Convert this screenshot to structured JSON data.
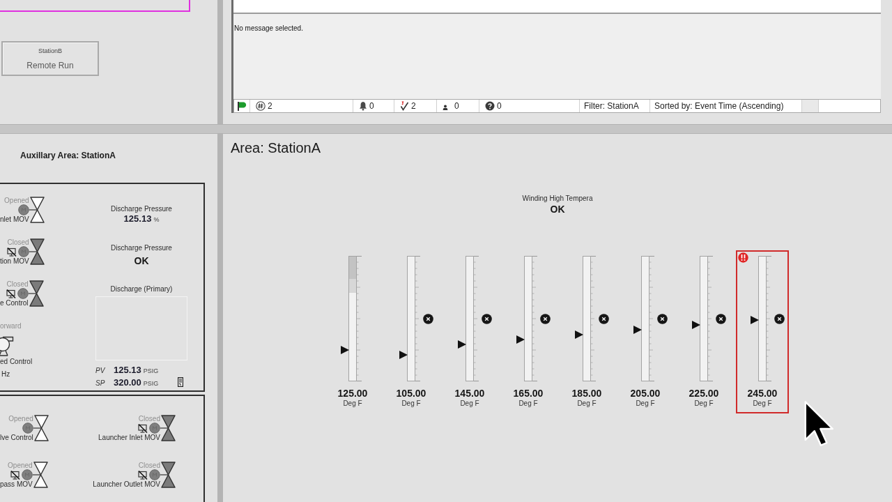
{
  "station_button": {
    "station": "StationB",
    "label": "Remote Run"
  },
  "alarm_viewer": {
    "message": "No message selected.",
    "status_bar": {
      "counters": [
        {
          "kind": "total",
          "value": "2"
        },
        {
          "kind": "bell",
          "value": "0"
        },
        {
          "kind": "acked",
          "value": "2"
        },
        {
          "kind": "shelved",
          "value": "0"
        },
        {
          "kind": "unknown",
          "value": "0"
        }
      ],
      "filter": "Filter: StationA",
      "sort": "Sorted by: Event Time (Ascending)"
    }
  },
  "aux_area": {
    "title": "Auxillary Area: StationA",
    "upper_valves": [
      {
        "status": "Opened",
        "open": true,
        "remote_disabled": false,
        "label": "nlet MOV"
      },
      {
        "status": "Closed",
        "open": false,
        "remote_disabled": true,
        "label": "tion MOV"
      },
      {
        "status": "Closed",
        "open": false,
        "remote_disabled": true,
        "label": "e Control"
      }
    ],
    "pump": {
      "status": "orward",
      "label": "ed Control",
      "reading": "Hz"
    },
    "readouts": [
      {
        "kind": "value",
        "label": "Discharge Pressure",
        "value": "125.13",
        "unit": "%"
      },
      {
        "kind": "status",
        "label": "Discharge Pressure",
        "value": "OK"
      }
    ],
    "trend": {
      "title": "Discharge (Primary)",
      "rows": [
        {
          "tag": "PV",
          "value": "125.13",
          "unit": "PSIG"
        },
        {
          "tag": "SP",
          "value": "320.00",
          "unit": "PSIG"
        }
      ]
    },
    "lower_valves": [
      {
        "status": "Opened",
        "open": true,
        "remote_disabled": false,
        "label": "lve Control"
      },
      {
        "status": "Closed",
        "open": false,
        "remote_disabled": true,
        "label": "Launcher Inlet MOV"
      },
      {
        "status": "Opened",
        "open": true,
        "remote_disabled": true,
        "label": "pass MOV"
      },
      {
        "status": "Closed",
        "open": false,
        "remote_disabled": true,
        "label": "Launcher Outlet MOV"
      }
    ]
  },
  "area": {
    "title": "Area: StationA",
    "status": {
      "label": "Winding High Tempera",
      "value": "OK"
    },
    "gauges": [
      {
        "value": "125.00",
        "unit": "Deg F",
        "level": 0.25,
        "limit_marker": false,
        "high_band": true,
        "in_alarm": false
      },
      {
        "value": "105.00",
        "unit": "Deg F",
        "level": 0.21,
        "limit_marker": true,
        "high_band": false,
        "in_alarm": false
      },
      {
        "value": "145.00",
        "unit": "Deg F",
        "level": 0.29,
        "limit_marker": true,
        "high_band": false,
        "in_alarm": false
      },
      {
        "value": "165.00",
        "unit": "Deg F",
        "level": 0.33,
        "limit_marker": true,
        "high_band": false,
        "in_alarm": false
      },
      {
        "value": "185.00",
        "unit": "Deg F",
        "level": 0.37,
        "limit_marker": true,
        "high_band": false,
        "in_alarm": false
      },
      {
        "value": "205.00",
        "unit": "Deg F",
        "level": 0.41,
        "limit_marker": true,
        "high_band": false,
        "in_alarm": false
      },
      {
        "value": "225.00",
        "unit": "Deg F",
        "level": 0.45,
        "limit_marker": true,
        "high_band": false,
        "in_alarm": false
      },
      {
        "value": "245.00",
        "unit": "Deg F",
        "level": 0.49,
        "limit_marker": true,
        "high_band": false,
        "in_alarm": true
      }
    ]
  }
}
